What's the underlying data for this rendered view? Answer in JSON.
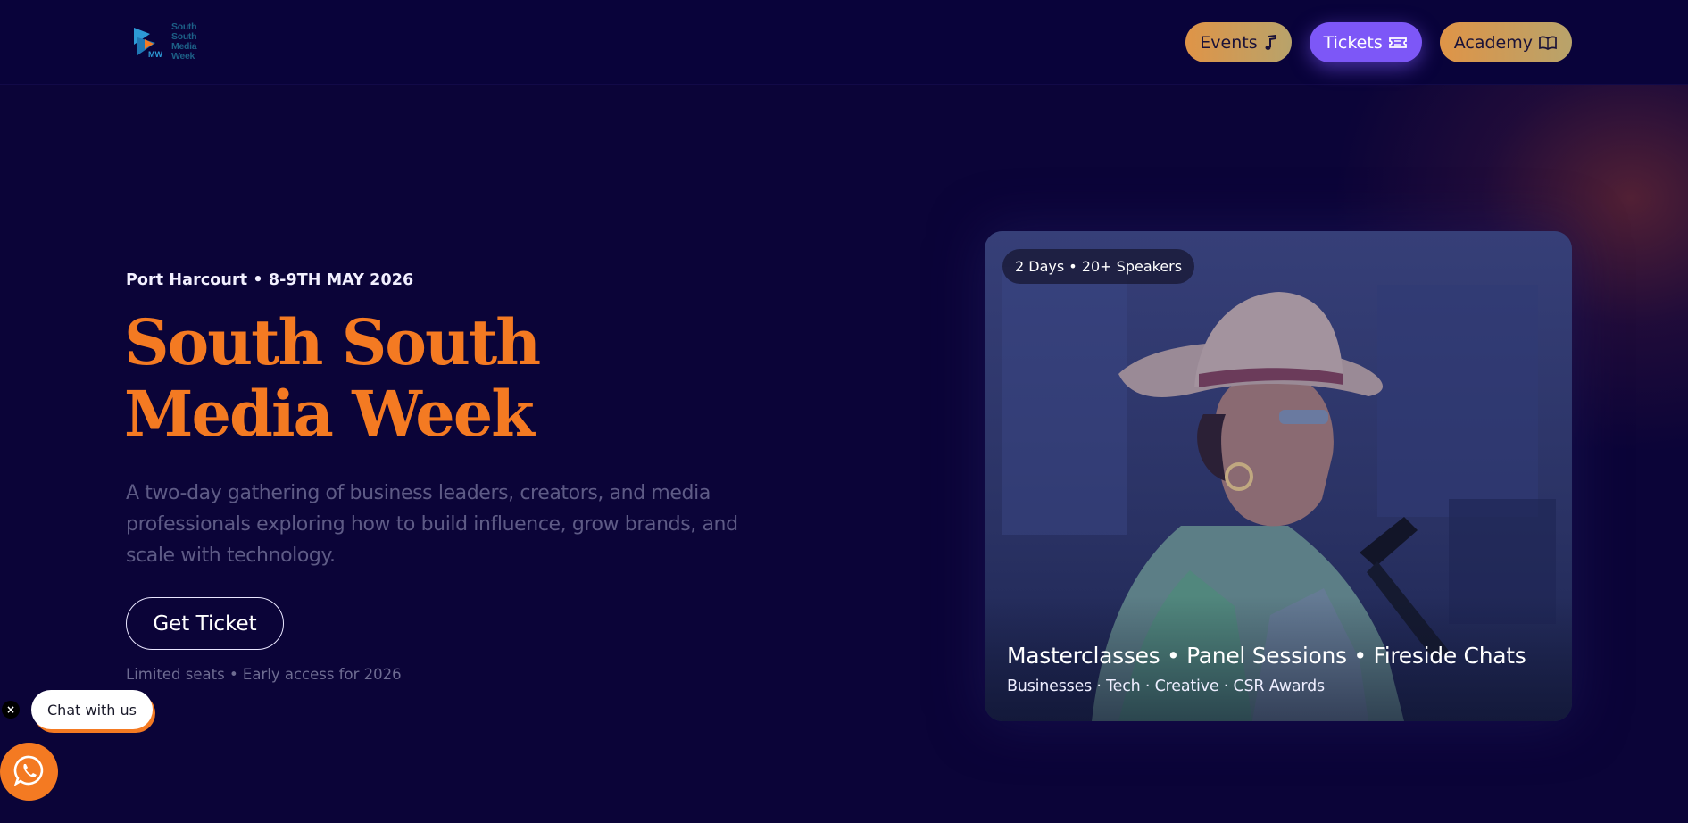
{
  "colors": {
    "background": "#0b0438",
    "accent_orange": "#f47a22",
    "tickets_purple": "#7d57f7",
    "pill_gradient_start": "#df9447",
    "pill_gradient_end": "#b8a36b"
  },
  "header": {
    "logo": {
      "text_line1": "South South",
      "text_line2": "Media Week",
      "mark_letters": "MW"
    },
    "nav": [
      {
        "label": "Events",
        "icon": "music-note-icon"
      },
      {
        "label": "Tickets",
        "icon": "ticket-icon"
      },
      {
        "label": "Academy",
        "icon": "open-book-icon"
      }
    ]
  },
  "hero": {
    "eyebrow": "Port Harcourt • 8-9TH MAY 2026",
    "title_line1": "South South",
    "title_line2": "Media Week",
    "description": "A two-day gathering of business leaders, creators, and media professionals exploring how to build influence, grow brands, and scale with technology.",
    "cta_label": "Get Ticket",
    "note": "Limited seats • Early access for 2026"
  },
  "card": {
    "badge": "2 Days • 20+ Speakers",
    "title": "Masterclasses • Panel Sessions • Fireside Chats",
    "subtitle": "Businesses · Tech · Creative · CSR Awards",
    "image_subject": "woman in a wide-brim hat speaking into a microphone"
  },
  "chat_widget": {
    "close_symbol": "×",
    "bubble_label": "Chat with us",
    "button_icon": "whatsapp-icon"
  }
}
